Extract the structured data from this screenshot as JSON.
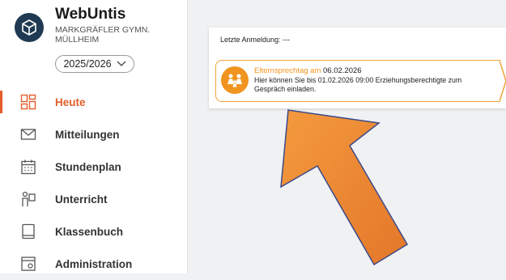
{
  "app": {
    "name": "WebUntis",
    "school": "MARKGRÄFLER GYMN. MÜLLHEIM",
    "year": "2025/2026"
  },
  "nav": {
    "items": [
      {
        "label": "Heute",
        "icon": "dashboard-icon",
        "active": true
      },
      {
        "label": "Mitteilungen",
        "icon": "mail-icon"
      },
      {
        "label": "Stundenplan",
        "icon": "calendar-icon"
      },
      {
        "label": "Unterricht",
        "icon": "teacher-icon"
      },
      {
        "label": "Klassenbuch",
        "icon": "book-icon"
      },
      {
        "label": "Administration",
        "icon": "admin-icon"
      }
    ]
  },
  "main": {
    "last_login": "Letzte Anmeldung: ---",
    "notice": {
      "title_highlight": "Elternsprechtag am",
      "title_date": "06.02.2026",
      "body": "Hier können Sie bis 01.02.2026 09:00 Erziehungsberechtigte zum Gespräch einladen."
    }
  },
  "colors": {
    "accent": "#e35d2a",
    "notice": "#f0941f",
    "arrow": "#f08a2c",
    "logo": "#1f3a52"
  }
}
